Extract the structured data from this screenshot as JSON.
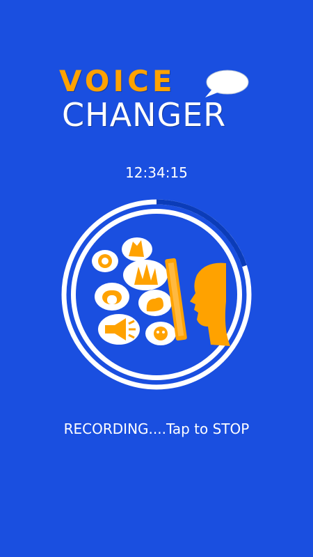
{
  "app": {
    "logo_top": "VOICE",
    "logo_bottom": "CHANGER"
  },
  "timer": {
    "value": "12:34:15"
  },
  "recorder": {
    "progress_fraction": 0.2,
    "status_text": "RECORDING....Tap to STOP"
  },
  "colors": {
    "background": "#1a4fe0",
    "accent": "#ffa200",
    "progress_track": "#ffffff",
    "progress_fill": "#0b3cb8"
  },
  "icons": [
    "speech-bubble-icon",
    "alien-icon",
    "chipmunk-icon",
    "monster-icon",
    "tunnel-icon",
    "squirrel-icon",
    "megaphone-icon",
    "skeleton-icon",
    "phone-icon",
    "girl-face-icon"
  ]
}
